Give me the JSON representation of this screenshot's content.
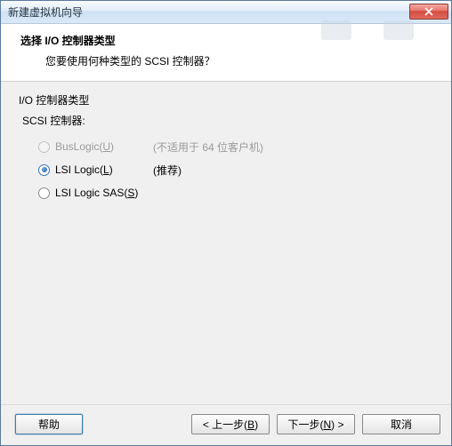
{
  "titlebar": {
    "title": "新建虚拟机向导"
  },
  "header": {
    "title": "选择 I/O 控制器类型",
    "subtitle": "您要使用何种类型的 SCSI 控制器？"
  },
  "content": {
    "section_label": "I/O 控制器类型",
    "sub_label": "SCSI 控制器:",
    "options": [
      {
        "label_pre": "BusLogic(",
        "accel": "U",
        "label_post": ")",
        "note": "(不适用于 64 位客户机)",
        "checked": false,
        "enabled": false
      },
      {
        "label_pre": "LSI Logic(",
        "accel": "L",
        "label_post": ")",
        "note": "(推荐)",
        "checked": true,
        "enabled": true
      },
      {
        "label_pre": "LSI Logic SAS(",
        "accel": "S",
        "label_post": ")",
        "note": "",
        "checked": false,
        "enabled": true
      }
    ]
  },
  "footer": {
    "help": "帮助",
    "back_pre": "< 上一步(",
    "back_accel": "B",
    "back_post": ")",
    "next_pre": "下一步(",
    "next_accel": "N",
    "next_post": ") >",
    "cancel": "取消"
  }
}
